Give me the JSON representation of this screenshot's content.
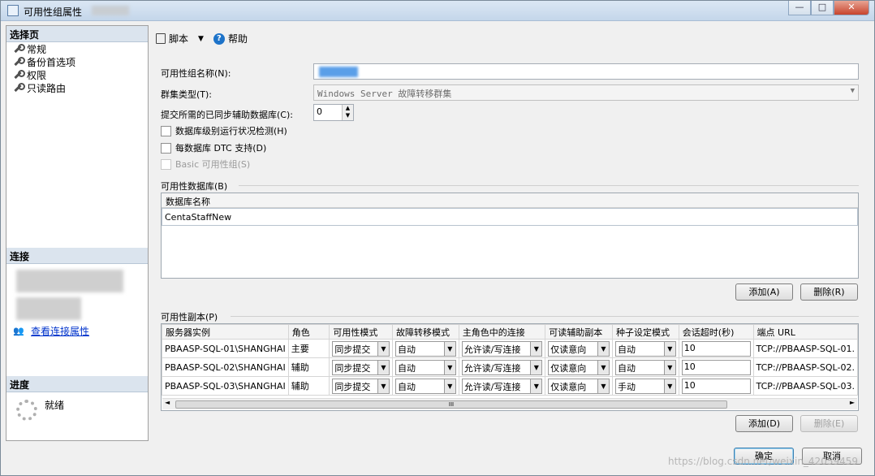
{
  "window": {
    "title": "可用性组属性",
    "buttons": {
      "minimize": "—",
      "maximize": "□",
      "close": "✕"
    }
  },
  "left": {
    "select_page_header": "选择页",
    "nav": [
      "常规",
      "备份首选项",
      "权限",
      "只读路由"
    ],
    "connection_header": "连接",
    "view_connection_link": "查看连接属性",
    "progress_header": "进度",
    "progress_status": "就绪"
  },
  "toolbar": {
    "script": "脚本",
    "help": "帮助"
  },
  "form": {
    "ag_name_label": "可用性组名称(N):",
    "cluster_type_label": "群集类型(T):",
    "cluster_type_value": "Windows Server 故障转移群集",
    "sync_required_label": "提交所需的已同步辅助数据库(C):",
    "sync_required_value": "0",
    "db_health_label": "数据库级别运行状况检测(H)",
    "dtc_label": "每数据库 DTC 支持(D)",
    "basic_label": "Basic 可用性组(S)"
  },
  "databases": {
    "section_label": "可用性数据库(B)",
    "column": "数据库名称",
    "rows": [
      "CentaStaffNew"
    ],
    "add_button": "添加(A)",
    "remove_button": "删除(R)"
  },
  "replicas": {
    "section_label": "可用性副本(P)",
    "columns": [
      "服务器实例",
      "角色",
      "可用性模式",
      "故障转移模式",
      "主角色中的连接",
      "可读辅助副本",
      "种子设定模式",
      "会话超时(秒)",
      "端点 URL"
    ],
    "rows": [
      {
        "server": "PBAASP-SQL-01\\SHANGHAI",
        "role": "主要",
        "mode": "同步提交",
        "failover": "自动",
        "primary_conn": "允许读/写连接",
        "readable": "仅读意向",
        "seeding": "自动",
        "timeout": "10",
        "endpoint": "TCP://PBAASP-SQL-01."
      },
      {
        "server": "PBAASP-SQL-02\\SHANGHAI",
        "role": "辅助",
        "mode": "同步提交",
        "failover": "自动",
        "primary_conn": "允许读/写连接",
        "readable": "仅读意向",
        "seeding": "自动",
        "timeout": "10",
        "endpoint": "TCP://PBAASP-SQL-02."
      },
      {
        "server": "PBAASP-SQL-03\\SHANGHAI",
        "role": "辅助",
        "mode": "同步提交",
        "failover": "自动",
        "primary_conn": "允许读/写连接",
        "readable": "仅读意向",
        "seeding": "手动",
        "timeout": "10",
        "endpoint": "TCP://PBAASP-SQL-03."
      }
    ],
    "add_button": "添加(D)",
    "remove_button": "删除(E)"
  },
  "footer": {
    "ok": "确定",
    "cancel": "取消",
    "watermark": "https://blog.csdn.net/weixin_42059459"
  }
}
